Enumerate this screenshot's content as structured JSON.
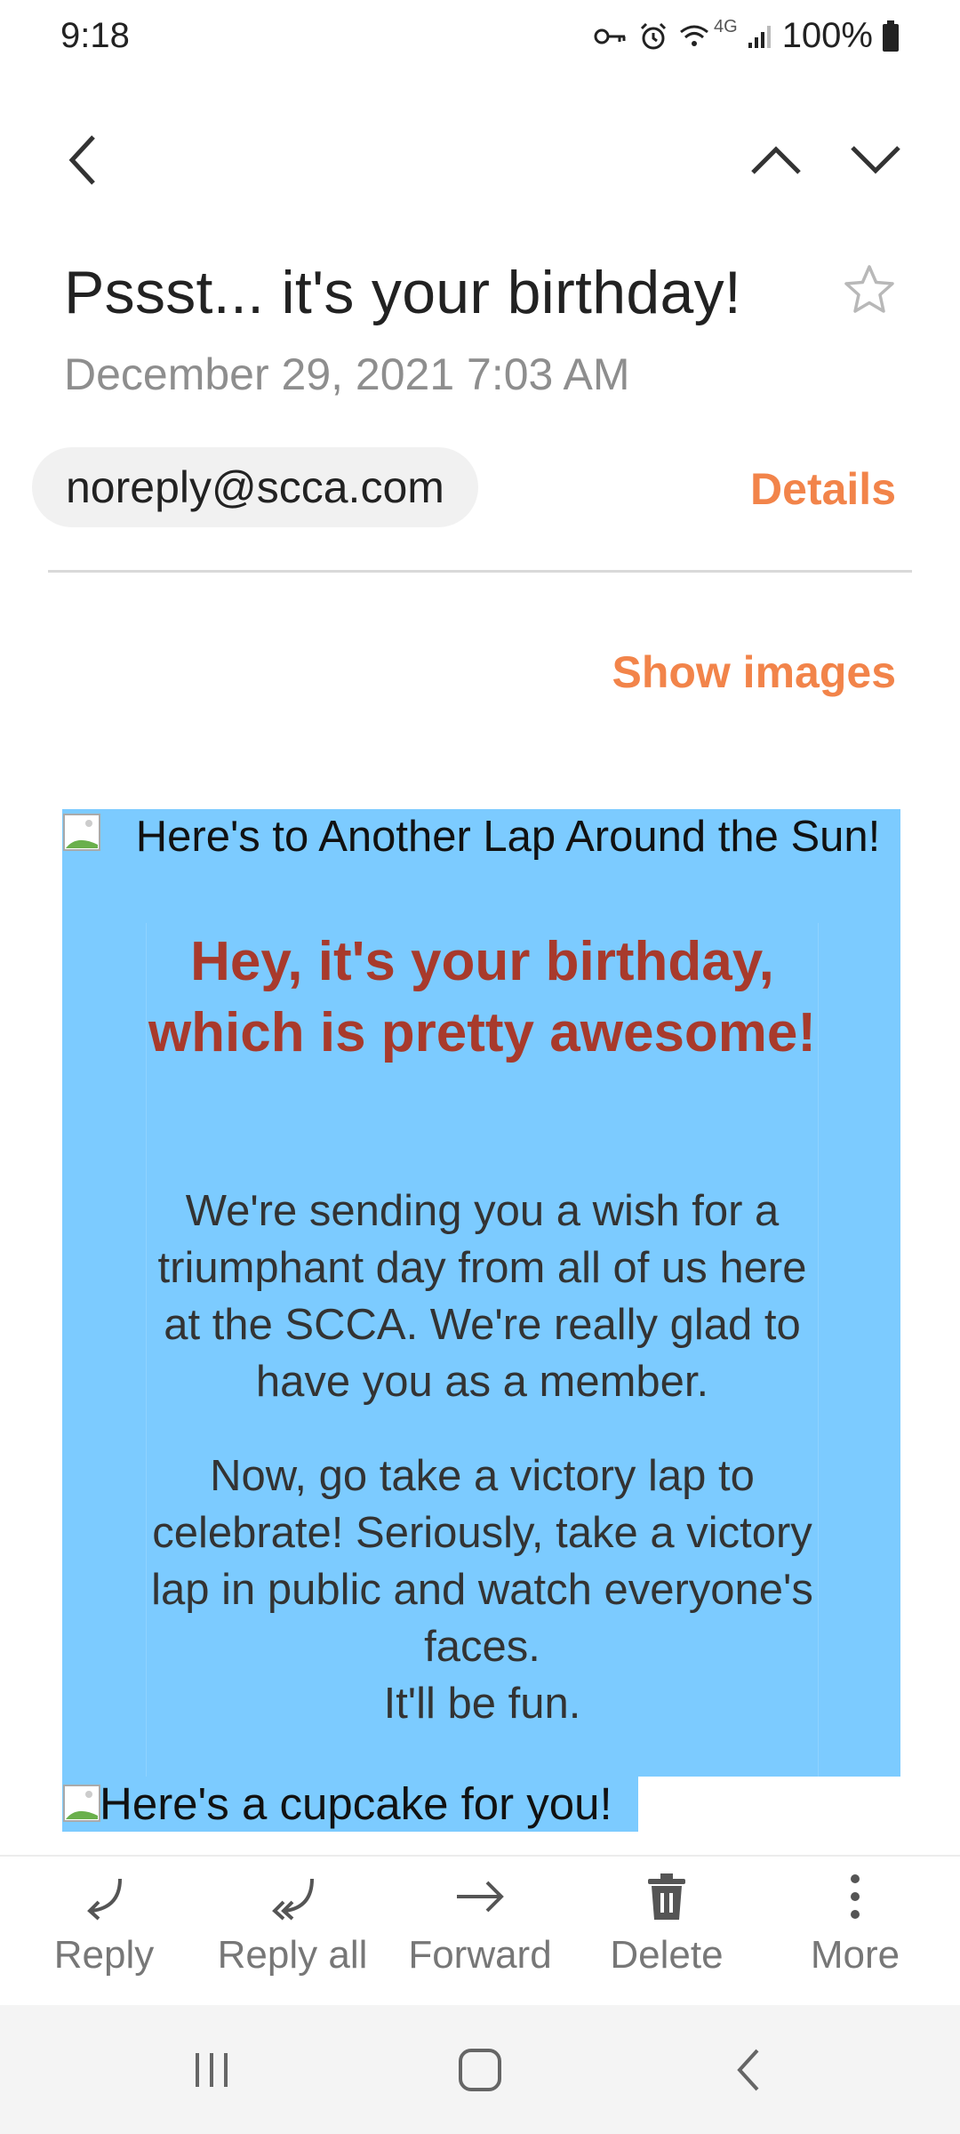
{
  "status_bar": {
    "time": "9:18",
    "network": "4G",
    "battery": "100%"
  },
  "header": {
    "back_icon": "chevron-left-icon",
    "prev_icon": "chevron-up-icon",
    "next_icon": "chevron-down-icon"
  },
  "email": {
    "subject": "Pssst... it's your birthday!",
    "date": "December 29, 2021  7:03 AM",
    "sender": "noreply@scca.com",
    "details_label": "Details",
    "show_images_label": "Show images",
    "body": {
      "banner_alt": "Here's to Another Lap Around the Sun!",
      "heading": "Hey, it's your birthday, which is pretty awesome!",
      "paragraph1": "We're sending you a wish for a triumphant day from all of us here at the SCCA. We're really glad to have you as a member.",
      "paragraph2": "Now, go take a victory lap to celebrate! Seriously, take a victory lap in public and watch everyone's faces.",
      "paragraph3": "It'll be fun.",
      "cupcake_alt": "Here's a cupcake for you!"
    }
  },
  "toolbar": {
    "reply": "Reply",
    "reply_all": "Reply all",
    "forward": "Forward",
    "delete": "Delete",
    "more": "More"
  },
  "colors": {
    "accent": "#f2844a",
    "email_background": "#7ccbff",
    "heading": "#a83a2c"
  }
}
